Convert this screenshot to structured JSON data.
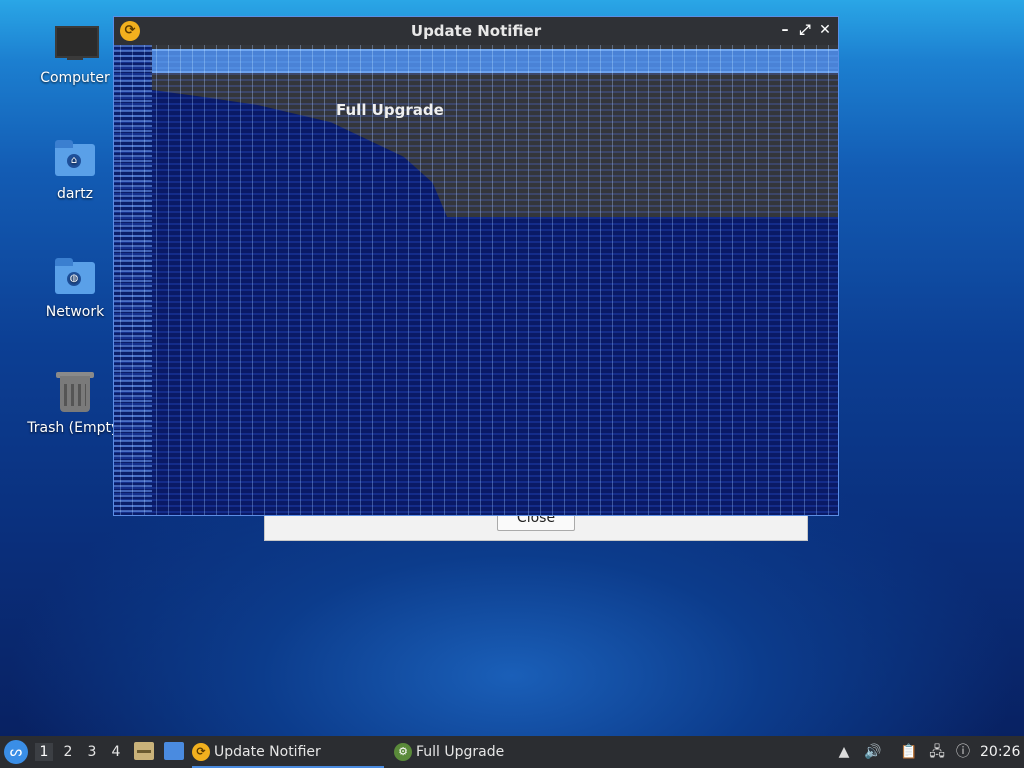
{
  "desktop": {
    "icons": [
      {
        "label": "Computer",
        "icon": "computer-icon"
      },
      {
        "label": "dartz",
        "icon": "home-folder-icon"
      },
      {
        "label": "Network",
        "icon": "network-folder-icon"
      },
      {
        "label": "Trash (Empty)",
        "icon": "trash-icon"
      }
    ]
  },
  "background_dialog": {
    "close_label": "Close"
  },
  "window": {
    "title": "Update Notifier",
    "app_icon": "update-notifier-icon",
    "controls": {
      "minimize": "–",
      "maximize": "⤢",
      "close": "✕"
    },
    "heading": "Full Upgrade"
  },
  "taskbar": {
    "start_icon": "start-menu-icon",
    "workspaces": [
      "1",
      "2",
      "3",
      "4"
    ],
    "active_workspace": "1",
    "tasks": [
      {
        "label": "Update Notifier",
        "icon": "update-notifier-icon",
        "active": true
      },
      {
        "label": "Full Upgrade",
        "icon": "gear-icon",
        "active": false
      }
    ],
    "tray_icons": [
      "up-arrow-icon",
      "volume-icon",
      "clipboard-icon",
      "network-icon",
      "update-badge-icon"
    ],
    "clock": "20:26"
  },
  "colors": {
    "accent": "#4a8be0",
    "titlebar": "#2f3136",
    "taskbar": "#2b2d31"
  }
}
